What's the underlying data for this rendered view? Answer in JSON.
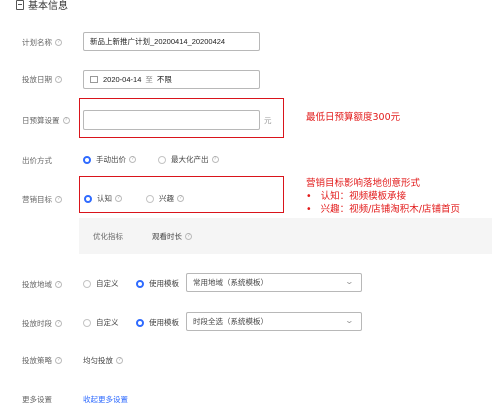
{
  "section": {
    "title": "基本信息"
  },
  "fields": {
    "plan_name": {
      "label": "计划名称",
      "value": "新品上新推广计划_20200414_20200424"
    },
    "date": {
      "label": "投放日期",
      "start": "2020-04-14",
      "sep": "至",
      "end": "不限"
    },
    "budget": {
      "label": "日预算设置",
      "value": "",
      "unit": "元"
    },
    "bid": {
      "label": "出价方式",
      "options": [
        "手动出价",
        "最大化产出"
      ],
      "selected": 0
    },
    "goal": {
      "label": "营销目标",
      "options": [
        "认知",
        "兴趣"
      ],
      "selected": 0
    },
    "optimize": {
      "label": "优化指标",
      "value": "观看时长"
    },
    "region": {
      "label": "投放地域",
      "options": [
        "自定义",
        "使用模板"
      ],
      "selected": 1,
      "template": "常用地域（系统模板）"
    },
    "time": {
      "label": "投放时段",
      "options": [
        "自定义",
        "使用模板"
      ],
      "selected": 1,
      "template": "时段全选（系统模板）"
    },
    "strategy": {
      "label": "投放策略",
      "value": "均匀投放"
    },
    "more": {
      "label": "更多设置",
      "link": "收起更多设置"
    }
  },
  "annotations": {
    "budget_note": "最低日预算额度300元",
    "goal_title": "营销目标影响落地创意形式",
    "goal_bullets": [
      {
        "bullet": "•",
        "text": "认知：视频模板承接"
      },
      {
        "bullet": "•",
        "text": "兴趣：视频/店铺淘积木/店铺首页"
      }
    ]
  },
  "colors": {
    "accent": "#2f6bff",
    "annotation": "#e21a1a",
    "link": "#2f6bff"
  }
}
